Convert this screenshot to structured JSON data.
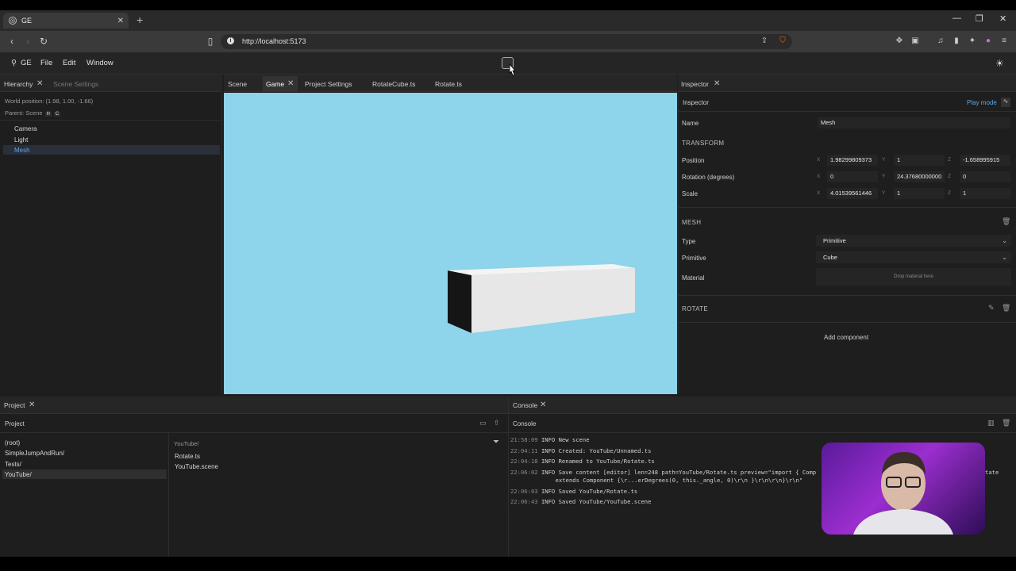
{
  "browser": {
    "tab_title": "GE",
    "url": "http://localhost:5173"
  },
  "menubar": {
    "app_label": "GE",
    "items": [
      "File",
      "Edit",
      "Window"
    ]
  },
  "hierarchy": {
    "tabs": [
      "Hierarchy",
      "Scene Settings"
    ],
    "world_position": "World position: (1.98, 1.00, -1.66)",
    "parent": "Parent: Scene",
    "parent_keys": [
      "H",
      "C"
    ],
    "items": [
      "Camera",
      "Light",
      "Mesh"
    ],
    "selected": "Mesh"
  },
  "center_tabs": [
    "Scene",
    "Game",
    "Project Settings",
    "RotateCube.ts",
    "Rotate.ts"
  ],
  "active_center_tab": "Game",
  "viewport": {
    "background": "#8ed4ea"
  },
  "inspector": {
    "tab": "Inspector",
    "header": "Inspector",
    "play_mode": "Play mode",
    "name_label": "Name",
    "name_value": "Mesh",
    "transform_title": "TRANSFORM",
    "position_label": "Position",
    "rotation_label": "Rotation (degrees)",
    "scale_label": "Scale",
    "position": [
      "1.98299809373",
      "1",
      "-1.658995915"
    ],
    "rotation": [
      "0",
      "24.37680000000",
      "0"
    ],
    "scale": [
      "4.01539561446",
      "1",
      "1"
    ],
    "axes": [
      "X",
      "Y",
      "Z"
    ],
    "mesh_title": "MESH",
    "type_label": "Type",
    "type_value": "Primitive",
    "primitive_label": "Primitive",
    "primitive_value": "Cube",
    "material_label": "Material",
    "material_placeholder": "Drop material here",
    "rotate_title": "ROTATE",
    "add_component": "Add component"
  },
  "project": {
    "tab": "Project",
    "header": "Project",
    "folders": [
      "(root)",
      "SimpleJumpAndRun/",
      "Tests/",
      "YouTube/"
    ],
    "selected_folder": "YouTube/",
    "path": "YouTube/",
    "files": [
      "Rotate.ts",
      "YouTube.scene"
    ]
  },
  "console": {
    "tab": "Console",
    "header": "Console",
    "lines": [
      {
        "time": "21:58:09",
        "text": "INFO New scene"
      },
      {
        "time": "22:04:11",
        "text": "INFO Created: YouTube/Unnamed.ts"
      },
      {
        "time": "22:04:18",
        "text": "INFO Renamed to YouTube/Rotate.ts"
      },
      {
        "time": "22:06:02",
        "text": "INFO Save content [editor] len=248 path=YouTube/Rotate.ts preview=\"import { Comp"
      },
      {
        "time": "",
        "text": "     extends Component {\\r...erDegrees(0, this._angle, 0)\\r\\n }\\r\\n\\r\\n}\\r\\n\""
      },
      {
        "time": "22:06:03",
        "text": "INFO Saved YouTube/Rotate.ts"
      },
      {
        "time": "22:06:43",
        "text": "INFO Saved YouTube/YouTube.scene"
      }
    ],
    "overflow_fragment": "tate"
  }
}
